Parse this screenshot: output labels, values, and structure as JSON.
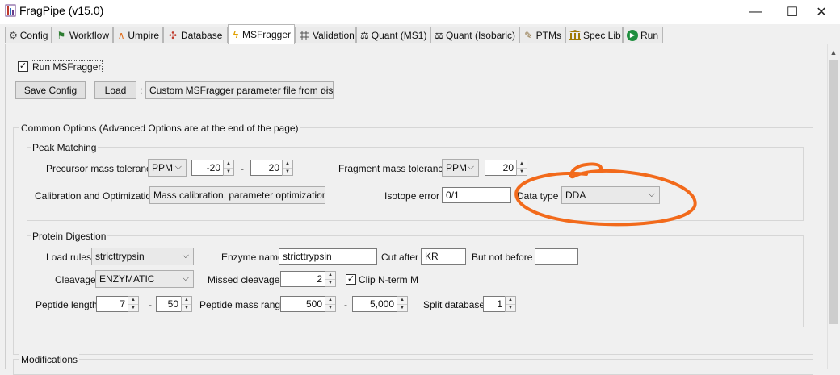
{
  "window": {
    "title": "FragPipe (v15.0)",
    "minimize_glyph": "—",
    "maximize_glyph": "☐",
    "close_glyph": "✕"
  },
  "tabs": [
    {
      "label": "Config",
      "icon": "gear-icon",
      "glyph": "⚙",
      "color": "#444444"
    },
    {
      "label": "Workflow",
      "icon": "workflow-icon",
      "glyph": "⚑",
      "color": "#2e7d32"
    },
    {
      "label": "Umpire",
      "icon": "peak-icon",
      "glyph": "∧",
      "color": "#e07020"
    },
    {
      "label": "Database",
      "icon": "molecule-icon",
      "glyph": "✣",
      "color": "#c0392b"
    },
    {
      "label": "MSFragger",
      "icon": "lightning-icon",
      "glyph": "ϟ",
      "color": "#e0a000"
    },
    {
      "label": "Validation",
      "icon": "validation-icon",
      "glyph": "‡",
      "color": "#555555"
    },
    {
      "label": "Quant (MS1)",
      "icon": "scale-icon",
      "glyph": "⚖",
      "color": "#333333"
    },
    {
      "label": "Quant (Isobaric)",
      "icon": "scale-icon",
      "glyph": "⚖",
      "color": "#333333"
    },
    {
      "label": "PTMs",
      "icon": "pencil-icon",
      "glyph": "✎",
      "color": "#8a6d3b"
    },
    {
      "label": "Spec Lib",
      "icon": "library-icon",
      "glyph": "⌂",
      "color": "#8a6d00"
    },
    {
      "label": "Run",
      "icon": "play-icon",
      "glyph": "▶",
      "color": "#ffffff"
    }
  ],
  "active_tab": "MSFragger",
  "run_msfragger": {
    "label": "Run MSFragger",
    "checked": true
  },
  "toolbar": {
    "save_config": "Save Config",
    "load": "Load",
    "separator": ":",
    "load_source": "Custom MSFragger parameter file from disk"
  },
  "common_options": {
    "title": "Common Options (Advanced Options are at the end of the page)",
    "peak_matching": {
      "title": "Peak Matching",
      "precursor_label": "Precursor mass tolerance",
      "precursor_unit": "PPM",
      "precursor_low": "-20",
      "dash": "-",
      "precursor_high": "20",
      "fragment_label": "Fragment mass tolerance",
      "fragment_unit": "PPM",
      "fragment_value": "20",
      "calibration_label": "Calibration and Optimization",
      "calibration_value": "Mass calibration, parameter optimization",
      "isotope_label": "Isotope error",
      "isotope_value": "0/1",
      "data_type_label": "Data type",
      "data_type_value": "DDA"
    },
    "protein_digestion": {
      "title": "Protein Digestion",
      "load_rules_label": "Load rules",
      "load_rules_value": "stricttrypsin",
      "enzyme_name_label": "Enzyme name",
      "enzyme_name_value": "stricttrypsin",
      "cut_after_label": "Cut after",
      "cut_after_value": "KR",
      "but_not_before_label": "But not before",
      "but_not_before_value": "",
      "cleavage_label": "Cleavage",
      "cleavage_value": "ENZYMATIC",
      "missed_cleavages_label": "Missed cleavages",
      "missed_cleavages_value": "2",
      "clip_nterm_label": "Clip N-term M",
      "clip_nterm_checked": true,
      "peptide_length_label": "Peptide length",
      "peptide_length_min": "7",
      "peptide_length_max": "50",
      "dash": "-",
      "peptide_mass_range_label": "Peptide mass range",
      "peptide_mass_min": "500",
      "peptide_mass_max": "5,000",
      "split_database_label": "Split database",
      "split_database_value": "1"
    }
  },
  "modifications": {
    "title": "Modifications"
  },
  "annotation_color": "#f26a1b"
}
